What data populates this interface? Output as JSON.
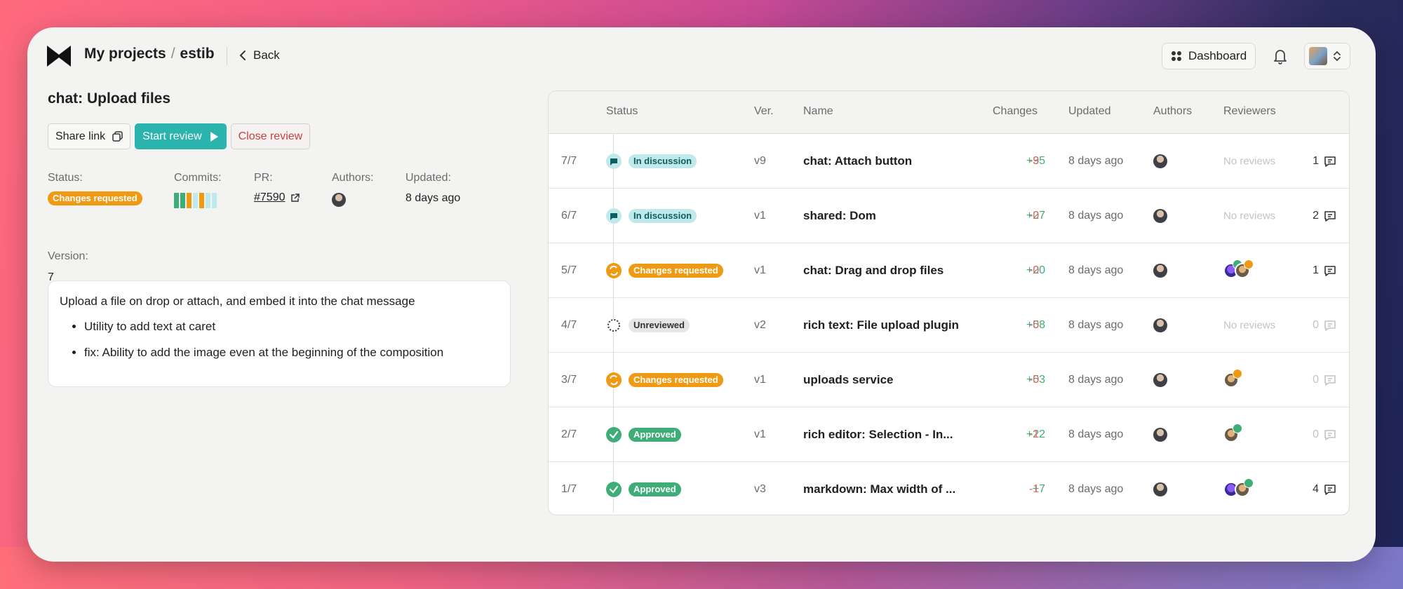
{
  "breadcrumb": {
    "root": "My projects",
    "separator": "/",
    "project": "estib"
  },
  "nav": {
    "back_label": "Back",
    "dashboard_label": "Dashboard"
  },
  "review": {
    "title": "chat: Upload files",
    "share_label": "Share link",
    "start_label": "Start review",
    "close_label": "Close review",
    "status_label": "Status:",
    "status_value": "Changes requested",
    "commits_label": "Commits:",
    "commit_colors": [
      "#3fad78",
      "#3fad78",
      "#ef9a12",
      "#bfe9ea",
      "#ef9a12",
      "#bfe9ea",
      "#bfe9ea"
    ],
    "pr_label": "PR:",
    "pr_value": "#7590",
    "authors_label": "Authors:",
    "updated_label": "Updated:",
    "updated_value": "8 days ago",
    "version_label": "Version:",
    "version_value": "7",
    "description": "Upload a file on drop or attach, and embed it into the chat message",
    "bullets": [
      "Utility to add text at caret",
      "fix: Ability to add the image even at the beginning of the composition"
    ]
  },
  "table": {
    "headers": {
      "status": "Status",
      "ver": "Ver.",
      "name": "Name",
      "changes": "Changes",
      "updated": "Updated",
      "authors": "Authors",
      "reviewers": "Reviewers"
    },
    "rows": [
      {
        "idx": "7/7",
        "status": "In discussion",
        "kind": "discussion",
        "ver": "v9",
        "name": "chat: Attach button",
        "plus": "+35",
        "minus": "-9",
        "updated": "8 days ago",
        "reviewers": "No reviews",
        "comments": "1"
      },
      {
        "idx": "6/7",
        "status": "In discussion",
        "kind": "discussion",
        "ver": "v1",
        "name": "shared: Dom",
        "plus": "+27",
        "minus": "-0",
        "updated": "8 days ago",
        "reviewers": "No reviews",
        "comments": "2"
      },
      {
        "idx": "5/7",
        "status": "Changes requested",
        "kind": "changes",
        "ver": "v1",
        "name": "chat: Drag and drop files",
        "plus": "+20",
        "minus": "-0",
        "updated": "8 days ago",
        "reviewers": "",
        "comments": "1"
      },
      {
        "idx": "4/7",
        "status": "Unreviewed",
        "kind": "unreviewed",
        "ver": "v2",
        "name": "rich text: File upload plugin",
        "plus": "+58",
        "minus": "-0",
        "updated": "8 days ago",
        "reviewers": "No reviews",
        "comments": "0"
      },
      {
        "idx": "3/7",
        "status": "Changes requested",
        "kind": "changes",
        "ver": "v1",
        "name": "uploads service",
        "plus": "+53",
        "minus": "-0",
        "updated": "8 days ago",
        "reviewers": "",
        "comments": "0"
      },
      {
        "idx": "2/7",
        "status": "Approved",
        "kind": "approved",
        "ver": "v1",
        "name": "rich editor: Selection - In...",
        "plus": "+22",
        "minus": "-1",
        "updated": "8 days ago",
        "reviewers": "",
        "comments": "0"
      },
      {
        "idx": "1/7",
        "status": "Approved",
        "kind": "approved",
        "ver": "v3",
        "name": "markdown: Max width of ...",
        "plus": "+7",
        "minus": "-1",
        "updated": "8 days ago",
        "reviewers": "",
        "comments": "4"
      }
    ]
  },
  "colors": {
    "accent": "#2bb3ad",
    "approved": "#3fad78",
    "changes": "#ef9a12",
    "discussion": "#bfe9ea",
    "danger": "#c94040"
  }
}
